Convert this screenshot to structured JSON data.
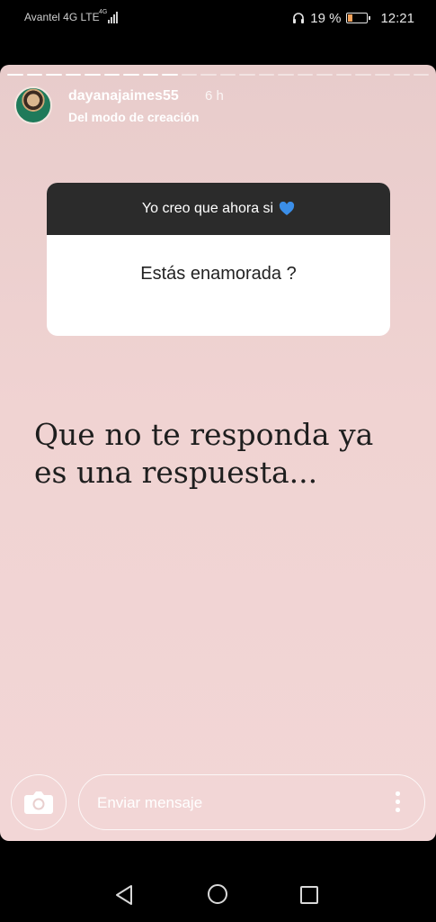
{
  "status_bar": {
    "carrier": "Avantel 4G LTE",
    "network_badge": "4G",
    "battery_percent": "19 %",
    "battery_level": 0.19,
    "time": "12:21",
    "icons": [
      "signal-icon",
      "headphones-icon",
      "battery-icon"
    ]
  },
  "story": {
    "username": "dayanajaimes55",
    "time_ago": "6 h",
    "subtitle": "Del modo de creación",
    "progress": {
      "segments": 22,
      "completed": 9
    },
    "question_box": {
      "header": "Yo creo que ahora si",
      "header_emoji": "blue-heart-icon",
      "question": "Estás enamorada ?"
    },
    "text_lines": [
      "Que no te responda ya",
      "es una respuesta..."
    ],
    "background_color": "#f0d3d2"
  },
  "reply_bar": {
    "camera_icon": "camera-icon",
    "placeholder": "Enviar mensaje",
    "more_icon": "more-vertical-icon"
  },
  "nav_bar": {
    "icons": [
      "back-icon",
      "home-icon",
      "recents-icon"
    ]
  }
}
